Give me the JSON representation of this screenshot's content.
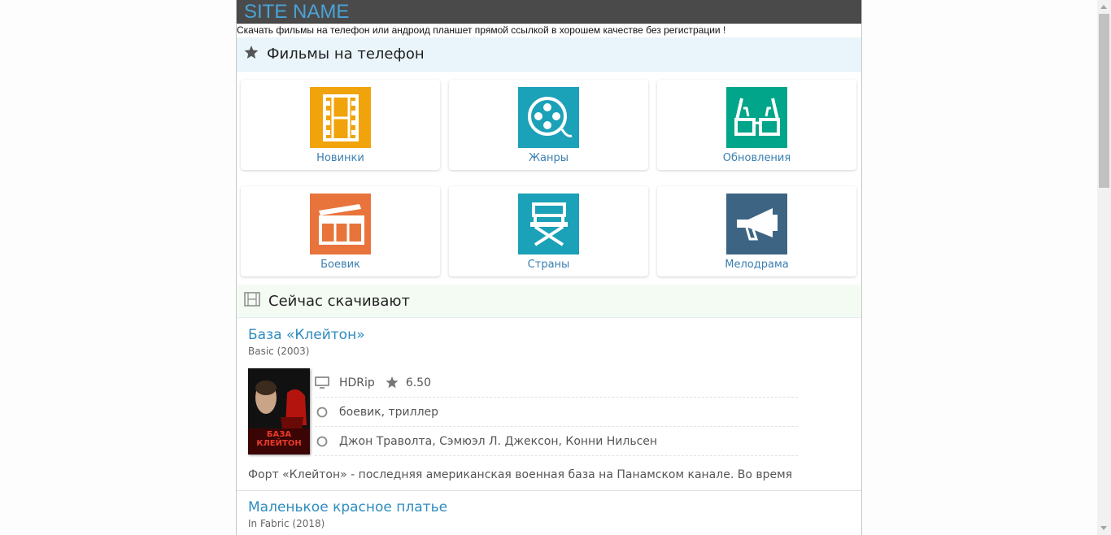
{
  "site": {
    "name": "SITE NAME",
    "tagline": "Скачать фильмы на телефон или андроид планшет прямой ссылкой в хорошем качестве без регистрации !"
  },
  "sections": {
    "films_title": "Фильмы на телефон",
    "downloading_title": "Сейчас скачивают"
  },
  "tiles": [
    {
      "label": "Новинки",
      "color": "#f0a30a",
      "icon": "film-strip-icon"
    },
    {
      "label": "Жанры",
      "color": "#1ba1b8",
      "icon": "film-reel-icon"
    },
    {
      "label": "Обновления",
      "color": "#00a58a",
      "icon": "3d-glasses-icon"
    },
    {
      "label": "Боевик",
      "color": "#e8743b",
      "icon": "clapperboard-icon"
    },
    {
      "label": "Страны",
      "color": "#1ba1b8",
      "icon": "director-chair-icon"
    },
    {
      "label": "Мелодрама",
      "color": "#3d6583",
      "icon": "megaphone-icon"
    }
  ],
  "movies": [
    {
      "title": "База «Клейтон»",
      "original": "Basic (2003)",
      "quality": "HDRip",
      "rating": "6.50",
      "genres": "боевик, триллер",
      "cast": "Джон Траволта, Сэмюэл Л. Джексон, Конни Нильсен",
      "description": "Форт «Клейтон» - последняя американская военная база на Панамском канале. Во время",
      "poster_text": "БАЗА КЛЕЙТОН"
    },
    {
      "title": "Маленькое красное платье",
      "original": "In Fabric (2018)"
    }
  ]
}
